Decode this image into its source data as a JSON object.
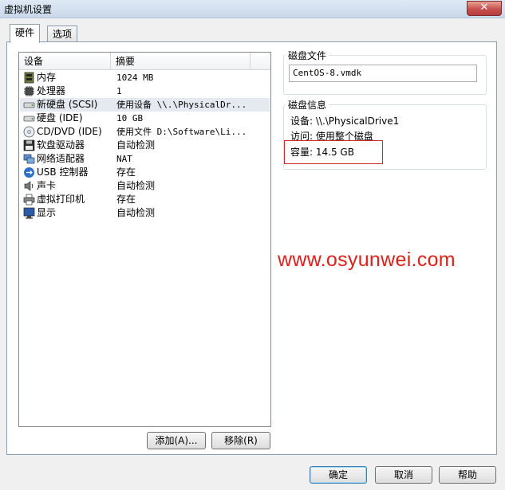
{
  "window": {
    "title": "虚拟机设置",
    "close_label": "✕"
  },
  "tabs": [
    {
      "label": "硬件",
      "active": true
    },
    {
      "label": "选项",
      "active": false
    }
  ],
  "device_list": {
    "columns": [
      "设备",
      "摘要"
    ],
    "rows": [
      {
        "device": "内存",
        "summary": "1024 MB",
        "icon": "memory-icon"
      },
      {
        "device": "处理器",
        "summary": "1",
        "icon": "cpu-icon"
      },
      {
        "device": "新硬盘 (SCSI)",
        "summary": "使用设备 \\\\.\\PhysicalDr...",
        "icon": "hard-disk-icon",
        "selected": true
      },
      {
        "device": "硬盘 (IDE)",
        "summary": "10 GB",
        "icon": "hard-disk-icon"
      },
      {
        "device": "CD/DVD (IDE)",
        "summary": "使用文件 D:\\Software\\Li...",
        "icon": "cd-dvd-icon"
      },
      {
        "device": "软盘驱动器",
        "summary": "自动检测",
        "icon": "floppy-icon"
      },
      {
        "device": "网络适配器",
        "summary": "NAT",
        "icon": "network-adapter-icon"
      },
      {
        "device": "USB 控制器",
        "summary": "存在",
        "icon": "usb-icon"
      },
      {
        "device": "声卡",
        "summary": "自动检测",
        "icon": "sound-card-icon"
      },
      {
        "device": "虚拟打印机",
        "summary": "存在",
        "icon": "printer-icon"
      },
      {
        "device": "显示",
        "summary": "自动检测",
        "icon": "display-icon"
      }
    ]
  },
  "list_buttons": {
    "add": "添加(A)...",
    "remove": "移除(R)"
  },
  "disk_file": {
    "label": "磁盘文件",
    "value": "CentOS-8.vmdk"
  },
  "disk_info": {
    "label": "磁盘信息",
    "device": "设备: \\\\.\\PhysicalDrive1",
    "access": "访问: 使用整个磁盘",
    "capacity": "容量: 14.5 GB"
  },
  "watermark": "www.osyunwei.com",
  "dialog_buttons": {
    "ok": "确定",
    "cancel": "取消",
    "help": "帮助"
  },
  "colors": {
    "highlight_box": "#cc2a2a",
    "watermark": "#e0201a",
    "selected_row": "#e5eaf1"
  }
}
